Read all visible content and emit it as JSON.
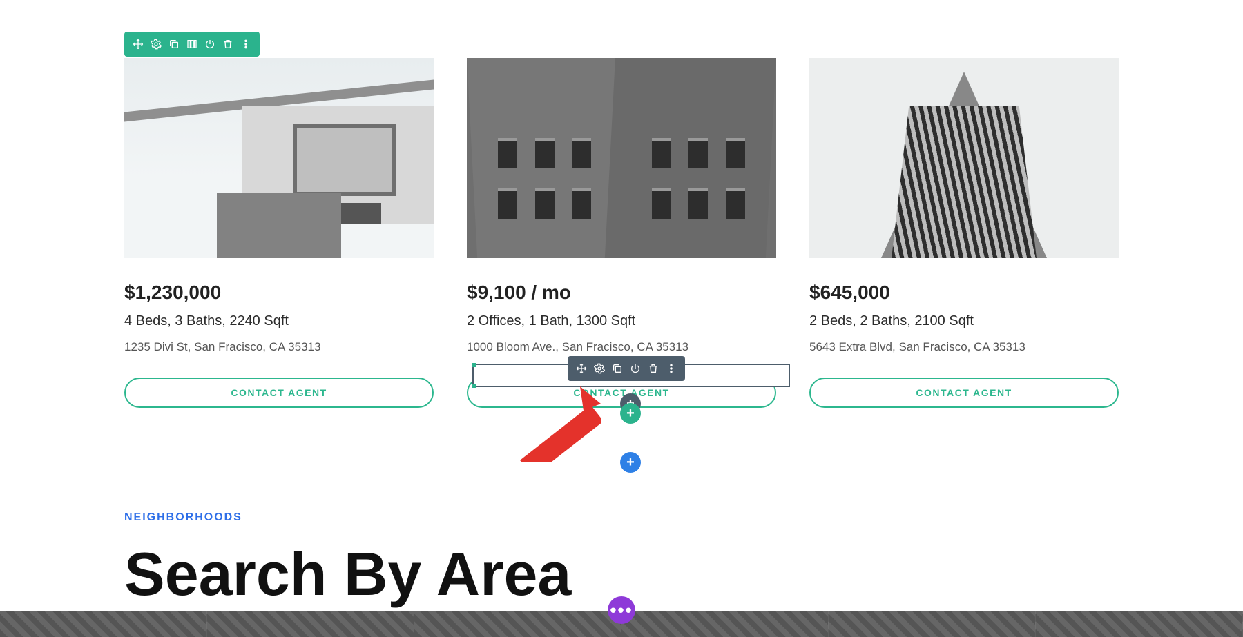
{
  "toolbars": {
    "section_icons": [
      "move-icon",
      "gear-icon",
      "duplicate-icon",
      "columns-icon",
      "power-icon",
      "trash-icon",
      "more-icon"
    ],
    "module_icons": [
      "move-icon",
      "gear-icon",
      "duplicate-icon",
      "power-icon",
      "trash-icon",
      "more-icon"
    ]
  },
  "cards": [
    {
      "price": "$1,230,000",
      "specs": "4 Beds, 3 Baths, 2240 Sqft",
      "address": "1235 Divi St, San Fracisco, CA 35313",
      "cta": "CONTACT AGENT"
    },
    {
      "price": "$9,100 / mo",
      "specs": "2 Offices, 1 Bath, 1300 Sqft",
      "address": "1000 Bloom Ave., San Fracisco, CA 35313",
      "cta": "CONTACT AGENT"
    },
    {
      "price": "$645,000",
      "specs": "2 Beds, 2 Baths, 2100 Sqft",
      "address": "5643 Extra Blvd, San Fracisco, CA 35313",
      "cta": "CONTACT AGENT"
    }
  ],
  "neighborhoods": {
    "eyebrow": "NEIGHBORHOODS",
    "heading": "Search By Area"
  },
  "fab_labels": {
    "plus": "+",
    "more": "•••"
  },
  "colors": {
    "brand_green": "#2bb38d",
    "toolbar_dark": "#4d5d6b",
    "fab_blue": "#2e80e6",
    "fab_purple": "#8e3ad8",
    "link_blue": "#2e6fe8",
    "annotation_red": "#e4322b"
  }
}
